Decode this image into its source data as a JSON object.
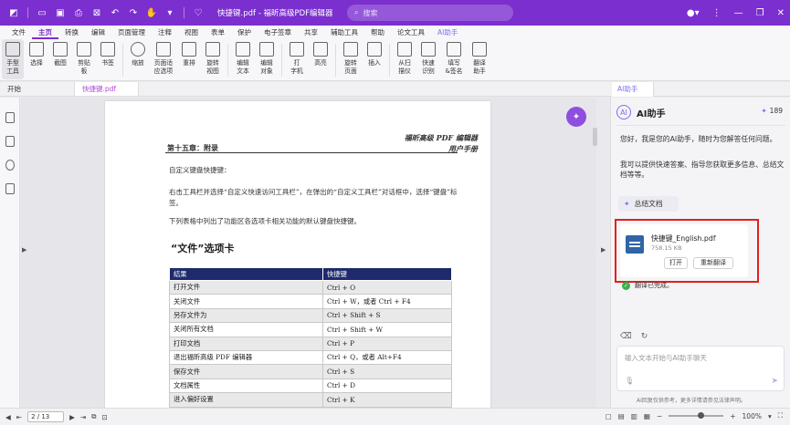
{
  "titlebar": {
    "doc_title": "快捷键.pdf - 福昕高级PDF编辑器",
    "search_placeholder": "搜索"
  },
  "menu": [
    "文件",
    "主页",
    "转换",
    "编辑",
    "页面管理",
    "注释",
    "视图",
    "表单",
    "保护",
    "电子签章",
    "共享",
    "辅助工具",
    "帮助",
    "论文工具",
    "AI助手"
  ],
  "ribbon": [
    "手型\n工具",
    "选择",
    "截图",
    "剪贴\n板",
    "书签",
    "缩放",
    "页面适\n应选项",
    "重排",
    "旋转\n视图",
    "编辑\n文本",
    "编辑\n对象",
    "打\n字机",
    "高亮",
    "旋转\n页面",
    "插入",
    "从扫\n描仪",
    "快速\n识别",
    "填写\n&签名",
    "翻译\n助手"
  ],
  "tabs": {
    "home": "开始",
    "doc": "快捷键.pdf"
  },
  "document": {
    "header_right_1": "福昕高级 PDF 编辑器",
    "header_right_2": "用户手册",
    "header_left": "第十五章：附录",
    "p1": "自定义键盘快捷键：",
    "p2": "右击工具栏并选择“自定义快速访问工具栏”，在弹出的“自定义工具栏”对话框中，选择“键盘”标签。",
    "p3": "下列表格中列出了功能区各选项卡相关功能的默认键盘快捷键。",
    "section_title": "“文件”选项卡",
    "table_headers": [
      "结果",
      "快捷键"
    ],
    "table_rows": [
      [
        "打开文件",
        "Ctrl + O"
      ],
      [
        "关闭文件",
        "Ctrl + W，或者  Ctrl + F4"
      ],
      [
        "另存文件为",
        "Ctrl + Shift + S"
      ],
      [
        "关闭所有文档",
        "Ctrl + Shift + W"
      ],
      [
        "打印文档",
        "Ctrl + P"
      ],
      [
        "退出福昕高级 PDF 编辑器",
        "Ctrl + Q，或者 Alt+F4"
      ],
      [
        "保存文件",
        "Ctrl + S"
      ],
      [
        "文档属性",
        "Ctrl + D"
      ],
      [
        "进入偏好设置",
        "Ctrl + K"
      ]
    ]
  },
  "ai": {
    "tab": "AI助手",
    "title": "AI助手",
    "credits": "189",
    "msg1": "您好，我是您的AI助手，随时为您解答任何问题。",
    "msg2": "我可以提供快速答案、指导您获取更多信息、总结文档等等。",
    "summary_btn": "总结文档",
    "file_name": "快捷键_English.pdf",
    "file_size": "758.15 KB",
    "open_btn": "打开",
    "retranslate_btn": "重新翻译",
    "done_text": "翻译已完成。",
    "input_placeholder": "输入文本开始与AI助手聊天",
    "disclaimer": "AI回复仅供参考，更多详情请参见法律声明。"
  },
  "status": {
    "page": "2 / 13",
    "zoom": "100%"
  }
}
